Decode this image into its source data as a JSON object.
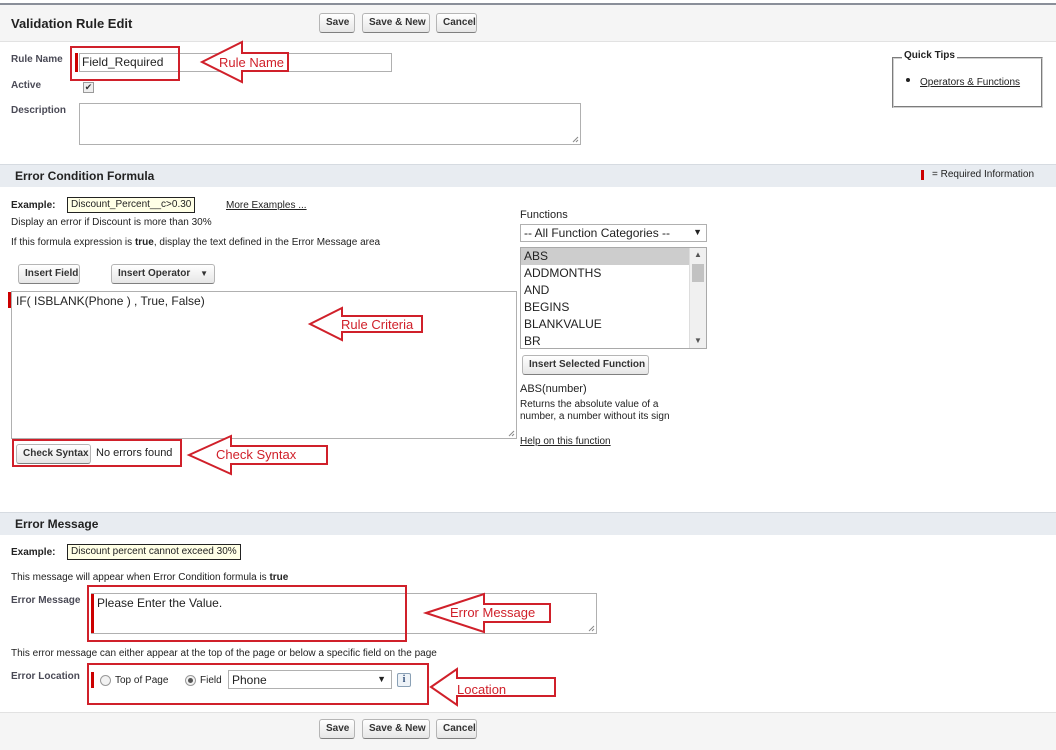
{
  "header": {
    "title": "Validation Rule Edit",
    "save_label": "Save",
    "save_new_label": "Save & New",
    "cancel_label": "Cancel"
  },
  "details": {
    "rule_name_label": "Rule Name",
    "rule_name_value": "Field_Required",
    "active_label": "Active",
    "active_checked": true,
    "description_label": "Description",
    "description_value": ""
  },
  "quick_tips": {
    "title": "Quick Tips",
    "link": "Operators & Functions"
  },
  "formula": {
    "section_title": "Error Condition Formula",
    "required_info": "= Required Information",
    "example_label": "Example:",
    "example_value": "Discount_Percent__c>0.30",
    "more_examples": "More Examples ...",
    "desc1": "Display an error if Discount is more than 30%",
    "desc2_pre": "If this formula expression is ",
    "desc2_bold": "true",
    "desc2_post": ", display the text defined in the Error Message area",
    "insert_field": "Insert Field",
    "insert_operator": "Insert Operator",
    "formula_text": "IF( ISBLANK(Phone ) , True, False)",
    "check_syntax": "Check Syntax",
    "syntax_result": "No errors found",
    "functions_label": "Functions",
    "categories_value": "-- All Function Categories --",
    "functions": [
      "ABS",
      "ADDMONTHS",
      "AND",
      "BEGINS",
      "BLANKVALUE",
      "BR"
    ],
    "insert_function": "Insert Selected Function",
    "function_signature": "ABS(number)",
    "function_desc1": "Returns the absolute value of a",
    "function_desc2": "number, a number without its sign",
    "help_link": "Help on this function"
  },
  "error_message": {
    "section_title": "Error Message",
    "example_label": "Example:",
    "example_value": "Discount percent cannot exceed 30%",
    "note_pre": "This message will appear when Error Condition formula is ",
    "note_bold": "true",
    "message_label": "Error Message",
    "message_value": "Please Enter the Value.",
    "location_note": "This error message can either appear at the top of the page or below a specific field on the page",
    "location_label": "Error Location",
    "top_of_page": "Top of Page",
    "field_option": "Field",
    "field_value": "Phone",
    "info_icon": "i"
  },
  "annotations": {
    "rule_name": "Rule Name",
    "rule_criteria": "Rule Criteria",
    "check_syntax": "Check Syntax",
    "error_message": "Error Message",
    "location": "Location",
    "color": "#d0202a"
  }
}
